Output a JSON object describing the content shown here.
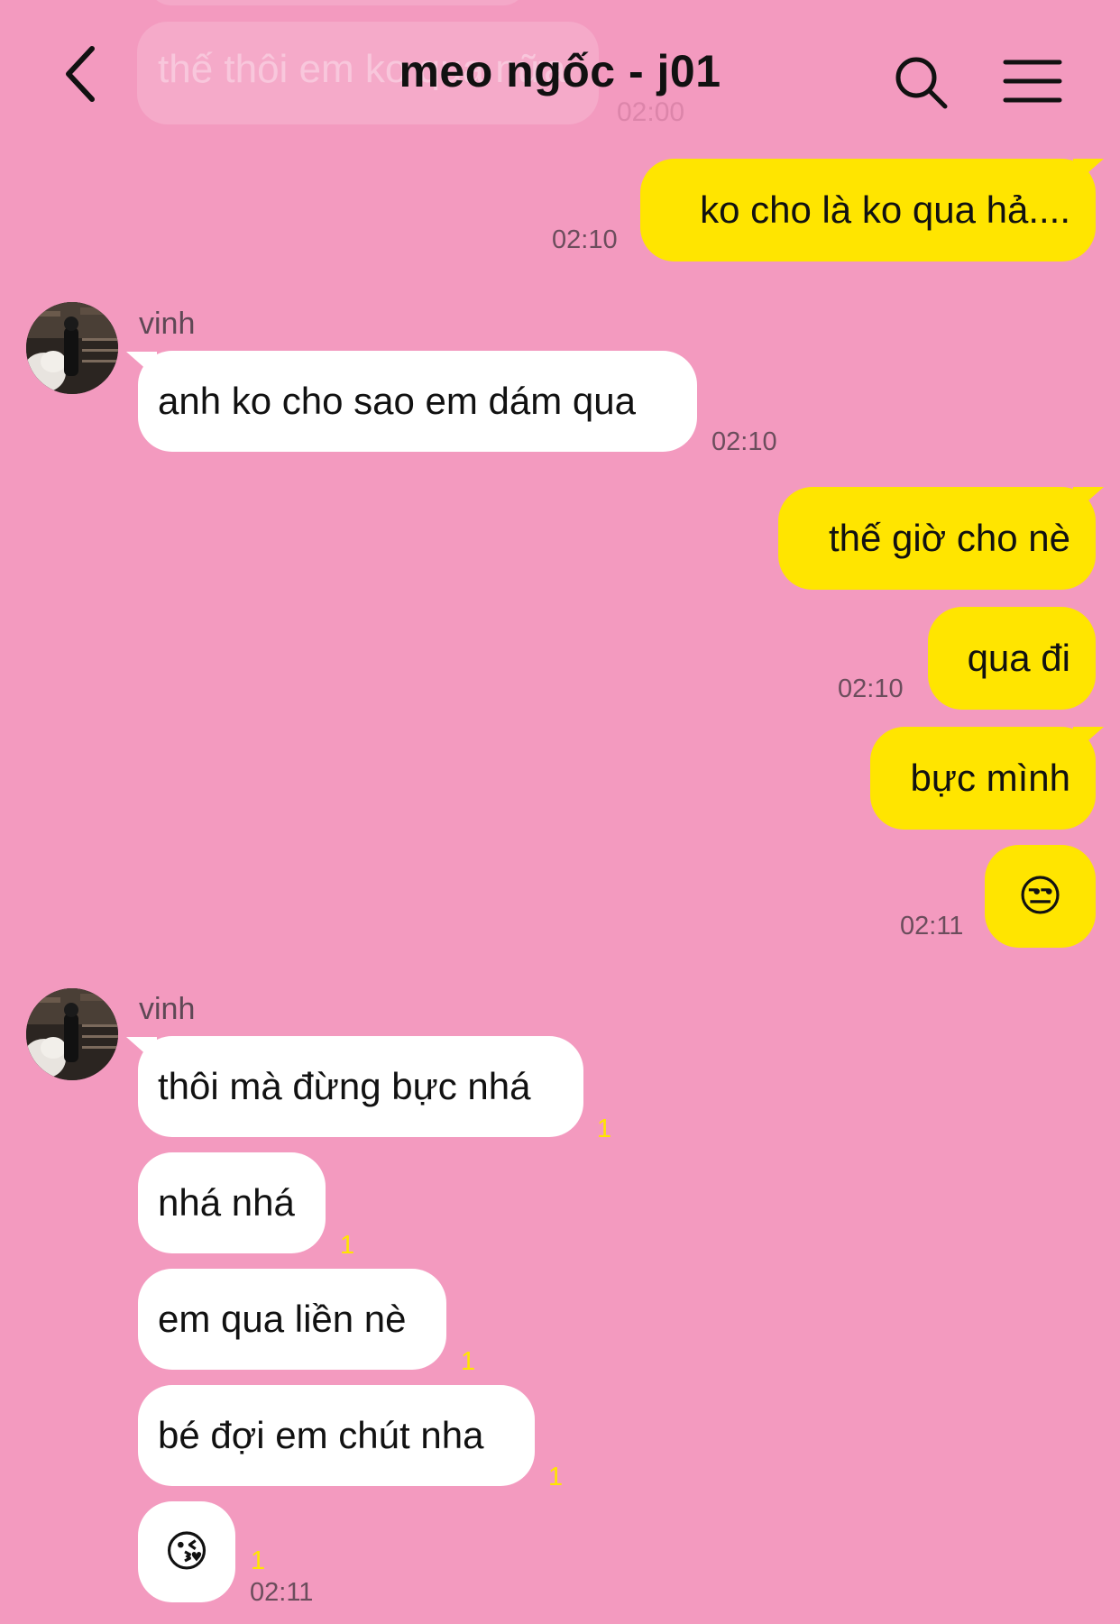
{
  "header": {
    "title": "meo ngốc - j01"
  },
  "previous_message": {
    "text": "thế thôi em ko qua nữa",
    "time": "02:00"
  },
  "messages": [
    {
      "dir": "out",
      "text": "ko cho là ko qua hả....",
      "time": "02:10"
    },
    {
      "dir": "in",
      "sender": "vinh",
      "text": "anh ko cho sao em dám qua",
      "time": "02:10"
    },
    {
      "dir": "out",
      "text": "thế giờ cho nè"
    },
    {
      "dir": "out",
      "text": "qua đi",
      "time": "02:10"
    },
    {
      "dir": "out",
      "text": "bực mình"
    },
    {
      "dir": "out",
      "text": "😒",
      "time": "02:11"
    },
    {
      "dir": "in",
      "sender": "vinh",
      "text": "thôi mà đừng bực nhá",
      "unread": "1"
    },
    {
      "dir": "in",
      "text": "nhá nhá",
      "unread": "1"
    },
    {
      "dir": "in",
      "text": "em qua liền nè",
      "unread": "1"
    },
    {
      "dir": "in",
      "text": "bé đợi em chút nha",
      "unread": "1"
    },
    {
      "dir": "in",
      "text": "😘",
      "unread": "1",
      "time": "02:11"
    }
  ],
  "colors": {
    "background": "#f39abf",
    "outgoing_bubble": "#ffe500",
    "incoming_bubble": "#ffffff",
    "unread_count": "#ffe500"
  },
  "icons": {
    "back": "chevron-left-icon",
    "search": "search-icon",
    "menu": "hamburger-menu-icon"
  }
}
